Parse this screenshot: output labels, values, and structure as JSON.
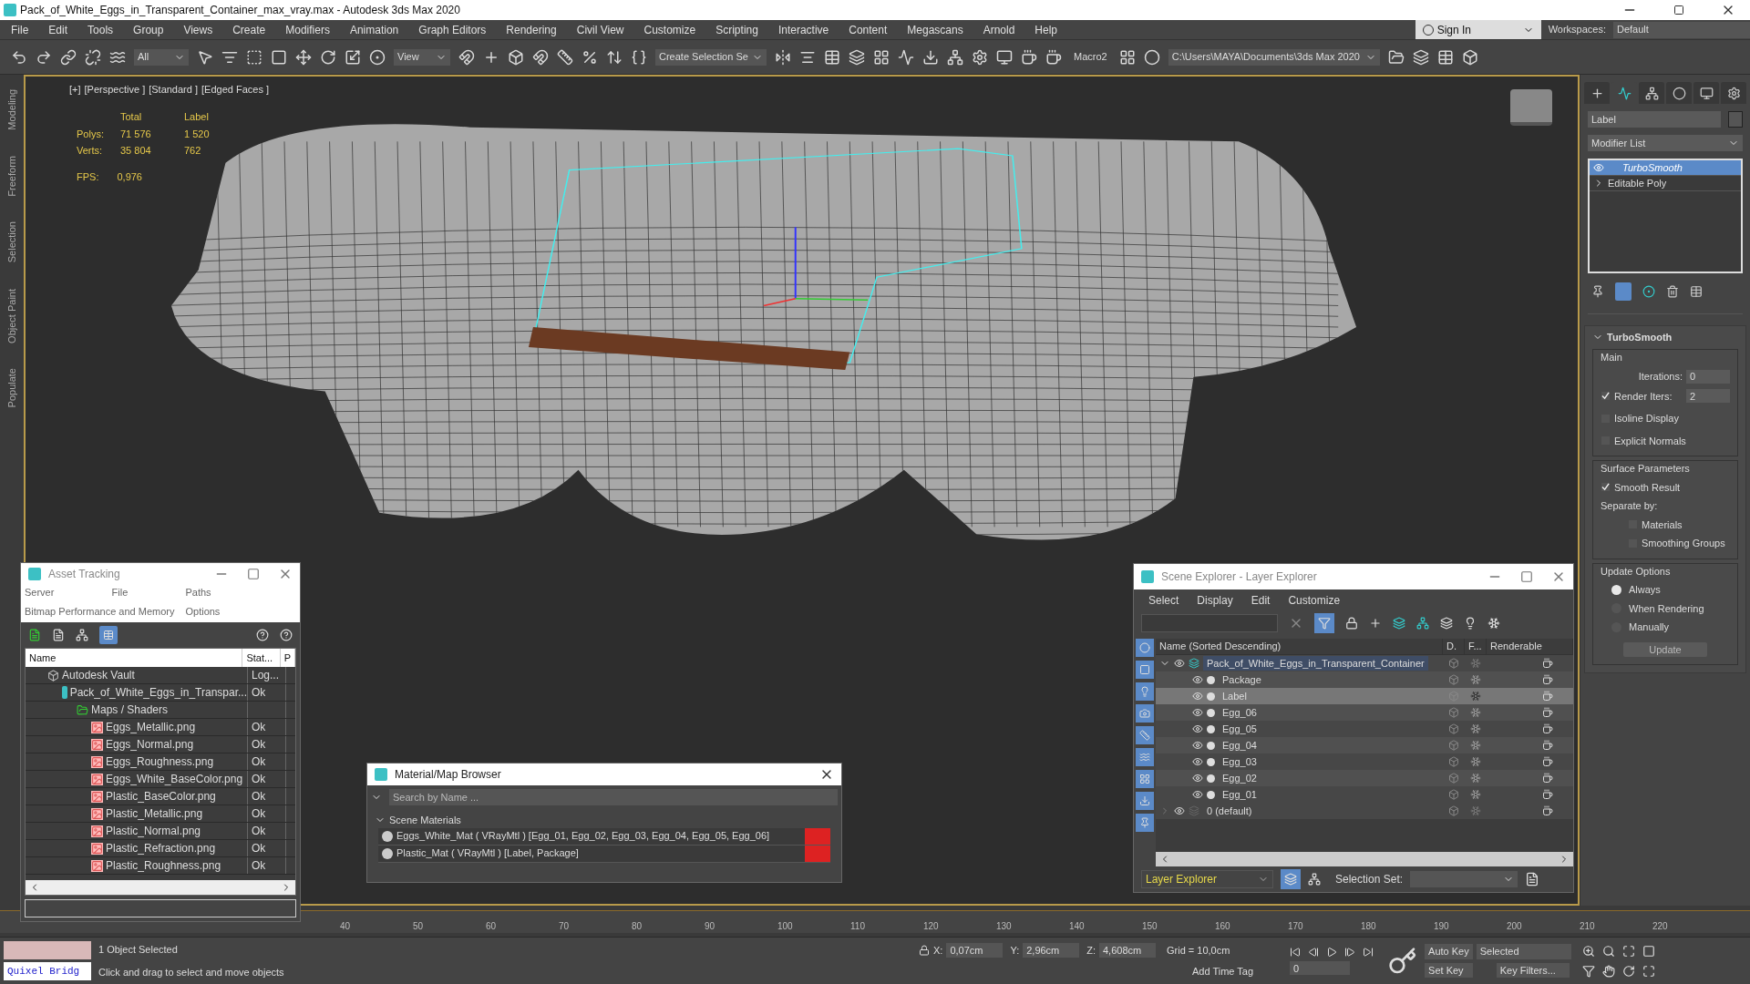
{
  "window": {
    "title": "Pack_of_White_Eggs_in_Transparent_Container_max_vray.max - Autodesk 3ds Max 2020",
    "sign_in": "Sign In",
    "workspaces_label": "Workspaces:",
    "workspace": "Default"
  },
  "menu": [
    "File",
    "Edit",
    "Tools",
    "Group",
    "Views",
    "Create",
    "Modifiers",
    "Animation",
    "Graph Editors",
    "Rendering",
    "Civil View",
    "Customize",
    "Scripting",
    "Interactive",
    "Content",
    "Megascans",
    "Arnold",
    "Help"
  ],
  "toolbar": {
    "selection_filter": "All",
    "reference_coord": "View",
    "named_selection": "Create Selection Se",
    "macro": "Macro2",
    "project_path": "C:\\Users\\MAYA\\Documents\\3ds Max 2020"
  },
  "ribbon_tabs": [
    "Modeling",
    "Freeform",
    "Selection",
    "Object Paint",
    "Populate"
  ],
  "viewport": {
    "labels": [
      "[+]",
      "[Perspective ]",
      "[Standard ]",
      "[Edged Faces ]"
    ],
    "stats": {
      "headers": [
        "Total",
        "Label"
      ],
      "rows": [
        {
          "label": "Polys:",
          "total": "71 576",
          "selected": "1 520"
        },
        {
          "label": "Verts:",
          "total": "35 804",
          "selected": "762"
        }
      ],
      "fps_label": "FPS:",
      "fps": "0,976"
    }
  },
  "command_panel": {
    "tabs": [
      {
        "selected": false
      },
      {
        "selected": true
      },
      {
        "selected": false
      },
      {
        "selected": false
      },
      {
        "selected": false
      },
      {
        "selected": false
      }
    ],
    "object_name": "Label",
    "modifier_list": "Modifier List",
    "stack": [
      {
        "name": "TurboSmooth",
        "selected": true
      },
      {
        "name": "Editable Poly",
        "selected": false
      }
    ],
    "rollout": {
      "title": "TurboSmooth",
      "main_group": "Main",
      "iterations_label": "Iterations:",
      "iterations": "0",
      "render_iters_label": "Render Iters:",
      "render_iters_checked": true,
      "render_iters": "2",
      "main_options": [
        {
          "label": "Isoline Display",
          "checked": false
        },
        {
          "label": "Explicit Normals",
          "checked": false
        }
      ],
      "surface_group": "Surface Parameters",
      "smooth_result": {
        "label": "Smooth Result",
        "checked": true
      },
      "separate_by": "Separate by:",
      "separate_options": [
        {
          "label": "Materials",
          "checked": false
        },
        {
          "label": "Smoothing Groups",
          "checked": false
        }
      ],
      "update_group": "Update Options",
      "update_options": [
        {
          "label": "Always",
          "selected": true
        },
        {
          "label": "When Rendering",
          "selected": false
        },
        {
          "label": "Manually",
          "selected": false
        }
      ],
      "update_button": "Update"
    }
  },
  "asset_tracking": {
    "title": "Asset Tracking",
    "menu": [
      "Server",
      "File",
      "Paths",
      "Bitmap Performance and Memory",
      "Options"
    ],
    "columns": [
      "Name",
      "Stat...",
      "P"
    ],
    "rows": [
      {
        "kind": "vault",
        "name": "Autodesk Vault",
        "status": "Log...",
        "children": [
          {
            "kind": "scene",
            "name": "Pack_of_White_Eggs_in_Transpar...",
            "status": "Ok",
            "children": [
              {
                "kind": "folder",
                "name": "Maps / Shaders",
                "children": [
                  {
                    "kind": "bitmap",
                    "name": "Eggs_Metallic.png",
                    "status": "Ok"
                  },
                  {
                    "kind": "bitmap",
                    "name": "Eggs_Normal.png",
                    "status": "Ok"
                  },
                  {
                    "kind": "bitmap",
                    "name": "Eggs_Roughness.png",
                    "status": "Ok"
                  },
                  {
                    "kind": "bitmap",
                    "name": "Eggs_White_BaseColor.png",
                    "status": "Ok"
                  },
                  {
                    "kind": "bitmap",
                    "name": "Plastic_BaseColor.png",
                    "status": "Ok"
                  },
                  {
                    "kind": "bitmap",
                    "name": "Plastic_Metallic.png",
                    "status": "Ok"
                  },
                  {
                    "kind": "bitmap",
                    "name": "Plastic_Normal.png",
                    "status": "Ok"
                  },
                  {
                    "kind": "bitmap",
                    "name": "Plastic_Refraction.png",
                    "status": "Ok"
                  },
                  {
                    "kind": "bitmap",
                    "name": "Plastic_Roughness.png",
                    "status": "Ok"
                  }
                ]
              }
            ]
          }
        ]
      }
    ]
  },
  "material_browser": {
    "title": "Material/Map Browser",
    "search_placeholder": "Search by Name ...",
    "group": "Scene Materials",
    "expanded": true,
    "materials": [
      "Eggs_White_Mat ( VRayMtl ) [Egg_01, Egg_02, Egg_03, Egg_04, Egg_05, Egg_06]",
      "Plastic_Mat ( VRayMtl ) [Label, Package]"
    ]
  },
  "scene_explorer": {
    "title": "Scene Explorer - Layer Explorer",
    "menu": [
      "Select",
      "Display",
      "Edit",
      "Customize"
    ],
    "columns": [
      "Name (Sorted Descending)",
      "D.",
      "F...",
      "Renderable"
    ],
    "layers": [
      {
        "name": "Pack_of_White_Eggs_in_Transparent_Container",
        "expanded": true,
        "children": [
          {
            "name": "Package",
            "selected": false
          },
          {
            "name": "Label",
            "selected": true
          },
          {
            "name": "Egg_06",
            "selected": false
          },
          {
            "name": "Egg_05",
            "selected": false
          },
          {
            "name": "Egg_04",
            "selected": false
          },
          {
            "name": "Egg_03",
            "selected": false
          },
          {
            "name": "Egg_02",
            "selected": false
          },
          {
            "name": "Egg_01",
            "selected": false
          }
        ]
      },
      {
        "name": "0 (default)",
        "expanded": false
      }
    ],
    "explorer_name": "Layer Explorer",
    "selection_set_label": "Selection Set:"
  },
  "timeline": {
    "ticks": [
      "40",
      "50",
      "60",
      "70",
      "80",
      "90",
      "100",
      "110",
      "120",
      "130",
      "140",
      "150",
      "160",
      "170",
      "180",
      "190",
      "200",
      "210",
      "220"
    ]
  },
  "status_bar": {
    "quixel": "Quixel Bridg",
    "selection": "1 Object Selected",
    "prompt": "Click and drag to select and move objects",
    "x_label": "X:",
    "x": "0,07cm",
    "y_label": "Y:",
    "y": "2,96cm",
    "z_label": "Z:",
    "z": "4,608cm",
    "grid": "Grid = 10,0cm",
    "add_time_tag": "Add Time Tag",
    "auto_key": "Auto Key",
    "key_mode": "Selected",
    "set_key": "Set Key",
    "key_filters": "Key Filters...",
    "frame": "0"
  }
}
